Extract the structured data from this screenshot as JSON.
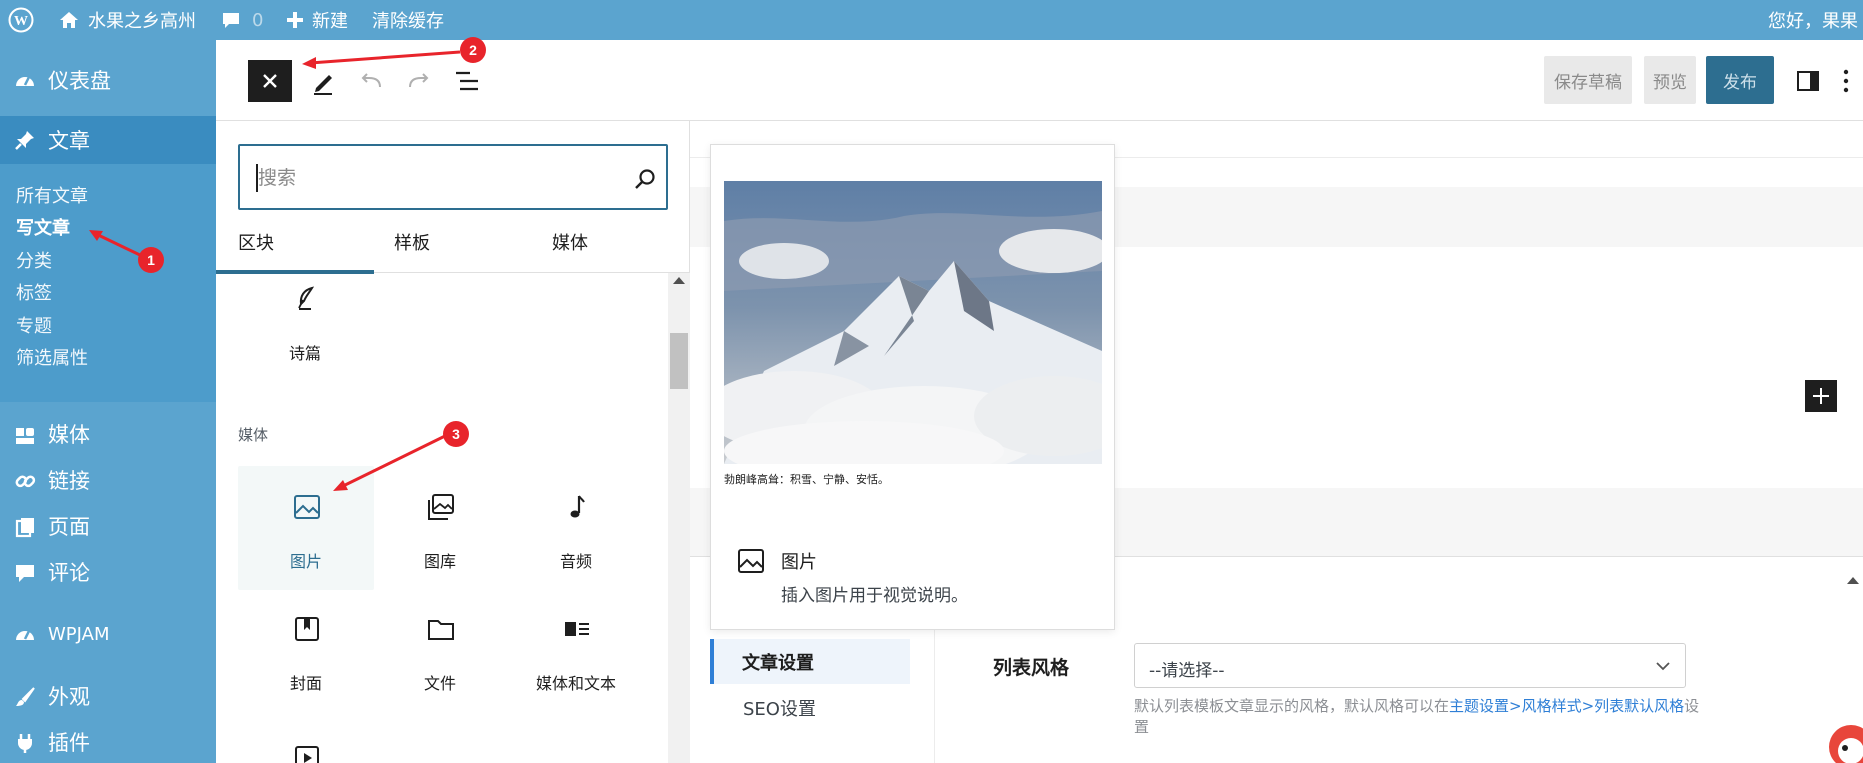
{
  "adminbar": {
    "site_name": "水果之乡高州",
    "comments_count": "0",
    "new_label": "新建",
    "clear_cache": "清除缓存",
    "greeting": "您好，果果"
  },
  "sidebar": {
    "items": [
      {
        "label": "仪表盘",
        "icon": "dashboard-icon"
      },
      {
        "label": "文章",
        "icon": "pin-icon"
      },
      {
        "label": "媒体",
        "icon": "media-icon"
      },
      {
        "label": "链接",
        "icon": "link-icon"
      },
      {
        "label": "页面",
        "icon": "page-icon"
      },
      {
        "label": "评论",
        "icon": "comment-icon"
      },
      {
        "label": "WPJAM",
        "icon": "gauge-icon"
      },
      {
        "label": "外观",
        "icon": "brush-icon"
      },
      {
        "label": "插件",
        "icon": "plug-icon"
      }
    ],
    "submenu": [
      "所有文章",
      "写文章",
      "分类",
      "标签",
      "专题",
      "筛选属性"
    ]
  },
  "header": {
    "save_draft": "保存草稿",
    "preview": "预览",
    "publish": "发布"
  },
  "inserter": {
    "search_placeholder": "搜索",
    "tabs": [
      "区块",
      "样板",
      "媒体"
    ],
    "category_media": "媒体",
    "blocks": [
      {
        "label": "诗篇",
        "icon": "verse-icon"
      },
      {
        "label": "图片",
        "icon": "image-icon"
      },
      {
        "label": "图库",
        "icon": "gallery-icon"
      },
      {
        "label": "音频",
        "icon": "audio-icon"
      },
      {
        "label": "封面",
        "icon": "cover-icon"
      },
      {
        "label": "文件",
        "icon": "file-icon"
      },
      {
        "label": "媒体和文本",
        "icon": "media-text-icon"
      }
    ]
  },
  "preview": {
    "caption": "勃朗峰高耸：积雪、宁静、安恬。",
    "title": "图片",
    "description": "插入图片用于视觉说明。"
  },
  "meta": {
    "nav_settings": "文章设置",
    "nav_seo": "SEO设置",
    "field_label": "列表风格",
    "select_value": "--请选择--",
    "desc_prefix": "默认列表模板文章显示的风格，默认风格可以在",
    "desc_link": "主题设置>风格样式>列表默认风格",
    "desc_suffix": "设置"
  },
  "annotations": [
    "1",
    "2",
    "3"
  ],
  "colors": {
    "admin_blue": "#5ba4cf",
    "active_blue": "#3a8cc0",
    "accent": "#2d6e90",
    "annotation_red": "#e8242b"
  }
}
